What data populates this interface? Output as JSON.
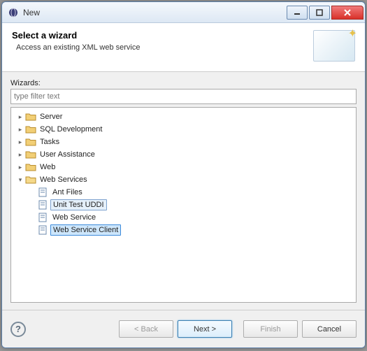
{
  "window": {
    "title": "New"
  },
  "banner": {
    "heading": "Select a wizard",
    "sub": "Access an existing XML web service"
  },
  "wizards": {
    "label": "Wizards:",
    "filter_placeholder": "type filter text",
    "tree": [
      {
        "label": "Server",
        "type": "folder",
        "expanded": false
      },
      {
        "label": "SQL Development",
        "type": "folder",
        "expanded": false
      },
      {
        "label": "Tasks",
        "type": "folder",
        "expanded": false
      },
      {
        "label": "User Assistance",
        "type": "folder",
        "expanded": false
      },
      {
        "label": "Web",
        "type": "folder",
        "expanded": false
      },
      {
        "label": "Web Services",
        "type": "folder",
        "expanded": true,
        "children": [
          {
            "label": "Ant Files",
            "icon": "ant"
          },
          {
            "label": "Unit Test UDDI",
            "icon": "uddi",
            "highlight": true
          },
          {
            "label": "Web Service",
            "icon": "ws"
          },
          {
            "label": "Web Service Client",
            "icon": "wsc",
            "selected": true
          }
        ]
      }
    ]
  },
  "buttons": {
    "back": "< Back",
    "next": "Next >",
    "finish": "Finish",
    "cancel": "Cancel"
  }
}
